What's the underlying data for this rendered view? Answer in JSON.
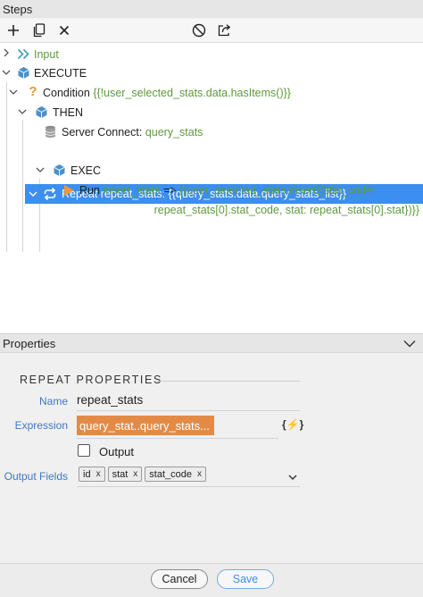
{
  "steps_panel": {
    "title": "Steps"
  },
  "toolbar": {
    "add_icon": "plus-icon",
    "copy_icon": "copy-icon",
    "delete_icon": "close-icon",
    "disable_icon": "disable-icon",
    "export_icon": "export-icon"
  },
  "tree": {
    "input": {
      "label": "Input"
    },
    "execute": {
      "label": "EXECUTE"
    },
    "condition": {
      "label": "Condition",
      "expr": "{{!user_selected_stats.data.hasItems()}}"
    },
    "then": {
      "label": "THEN"
    },
    "server_connect": {
      "label": "Server Connect:",
      "value": "query_stats"
    },
    "repeat": {
      "label": "Repeat repeat_stats: {{query_stats.data.query_stats_list}}"
    },
    "exec": {
      "label": "EXEC"
    },
    "run": {
      "label": "Run",
      "target": "insert_stats",
      "arrow": "=>",
      "expr_line1": "{{user_selected_stats.insert({stat_code:",
      "expr_line2": "repeat_stats[0].stat_code, stat: repeat_stats[0].stat})}}"
    }
  },
  "properties_panel": {
    "title": "Properties",
    "section_title": "REPEAT PROPERTIES",
    "name_label": "Name",
    "name_value": "repeat_stats",
    "expression_label": "Expression",
    "expression_value": "query_stat..query_stats...",
    "expression_button": "{⚡}",
    "output_checkbox_label": "Output",
    "output_checked": false,
    "output_fields_label": "Output Fields",
    "output_fields": [
      {
        "label": "id",
        "remove": "x"
      },
      {
        "label": "stat",
        "remove": "x"
      },
      {
        "label": "stat_code",
        "remove": "x"
      }
    ]
  },
  "footer": {
    "cancel_label": "Cancel",
    "save_label": "Save"
  },
  "colors": {
    "selection": "#3c8ef0",
    "label_blue": "#3f78c4",
    "expression_green": "#5d9a3c",
    "expression_chip": "#e38b46",
    "cube_blue": "#4d90c8",
    "condition_orange": "#e69a2e",
    "run_orange": "#f0963c"
  }
}
